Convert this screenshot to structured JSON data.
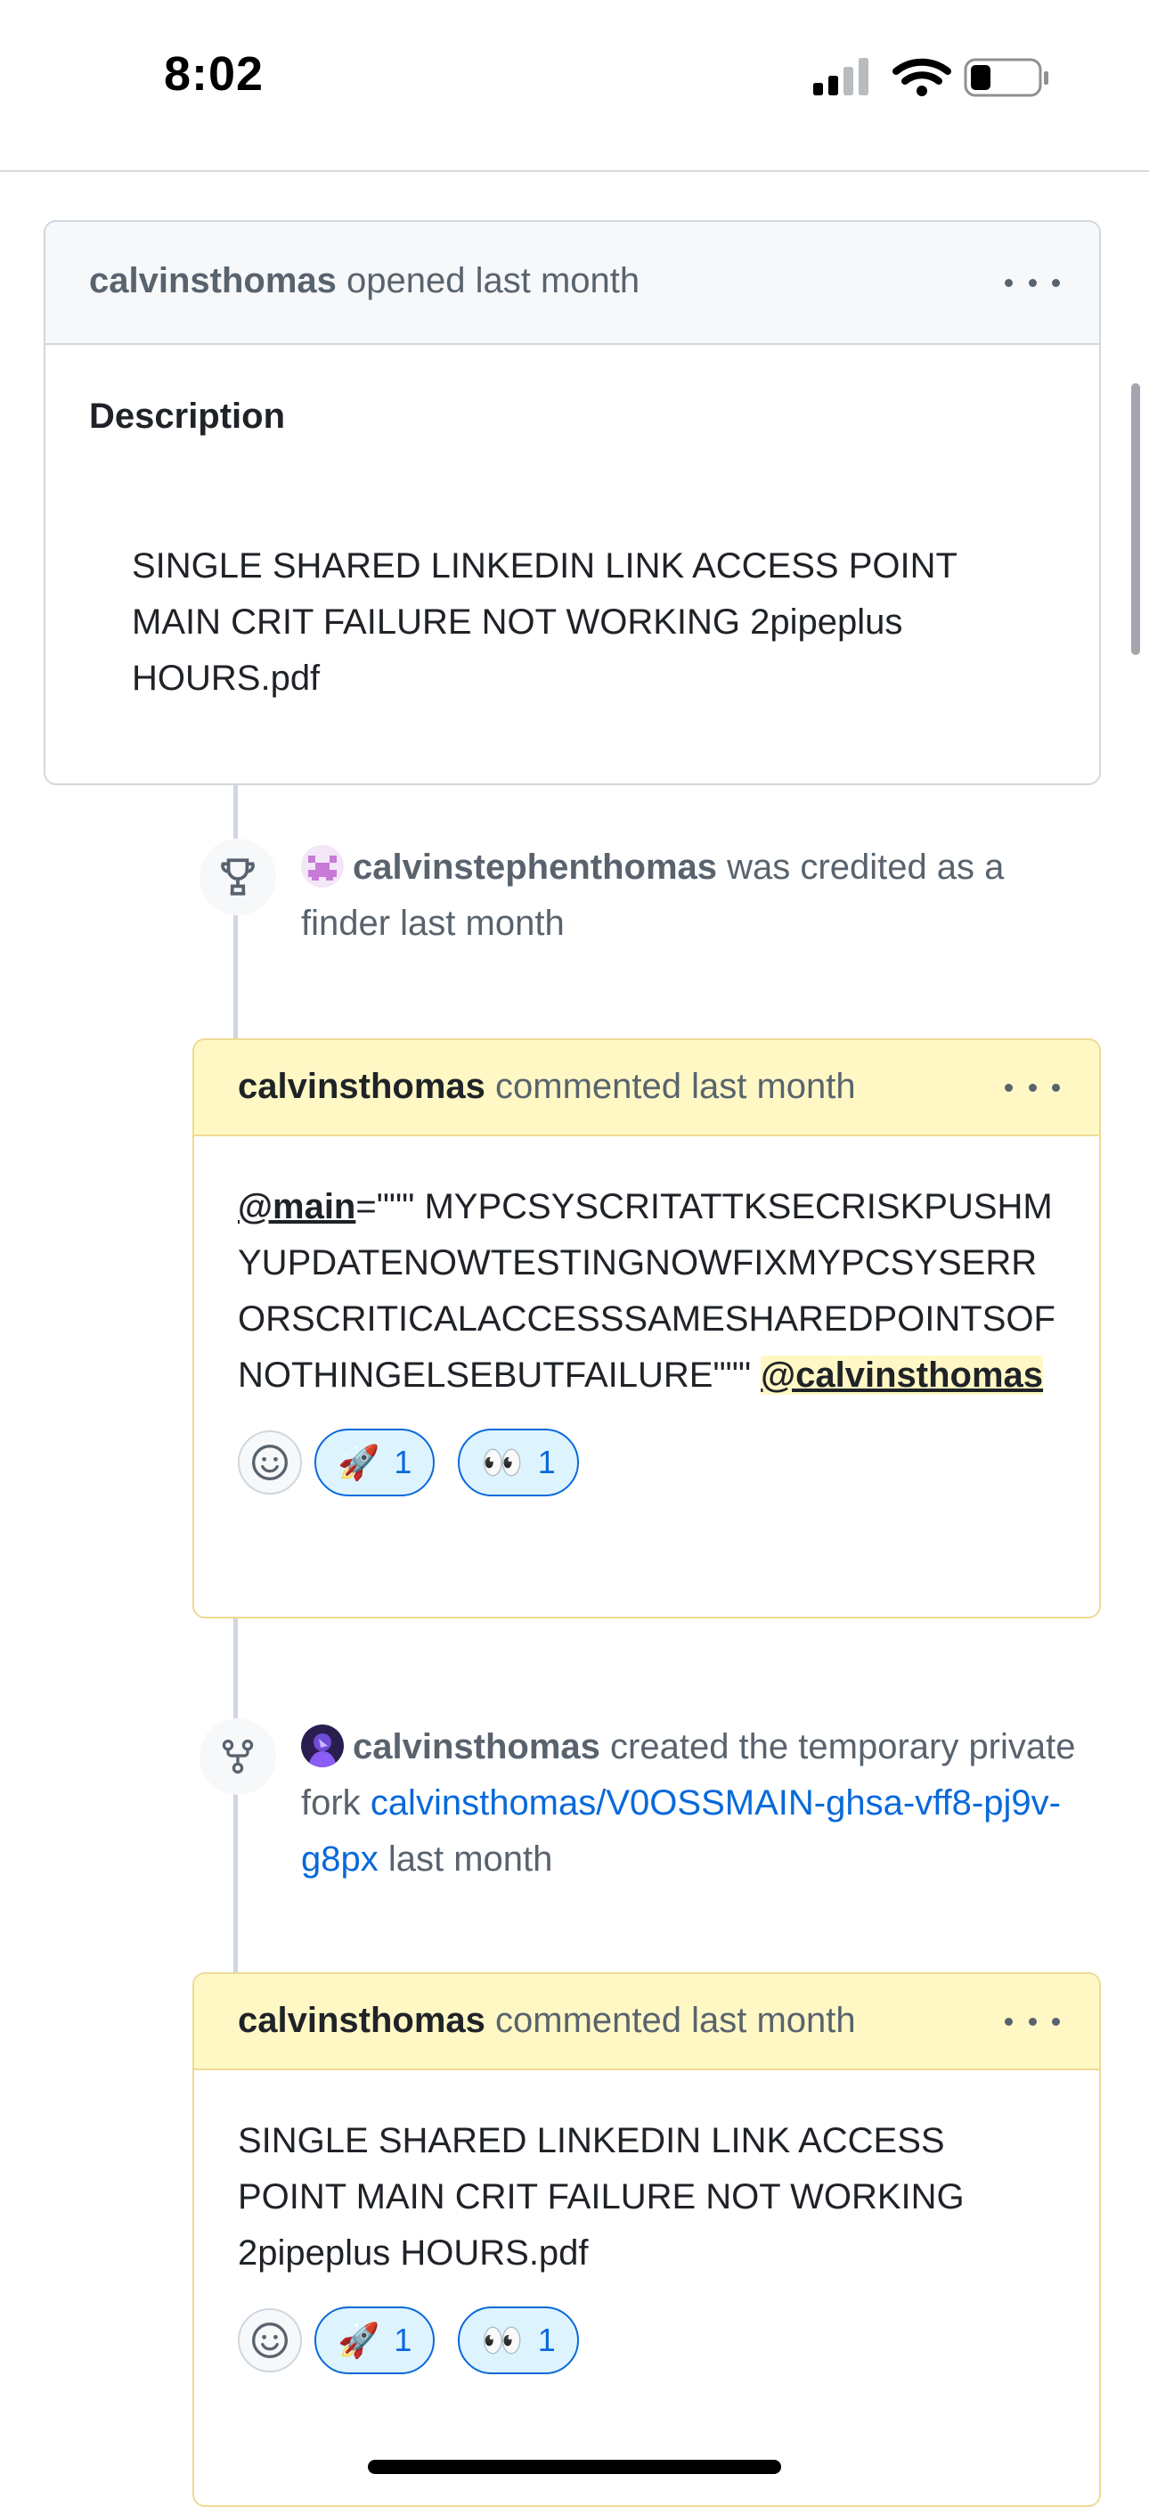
{
  "status_bar": {
    "time": "8:02",
    "icons": [
      "cellular-signal-icon",
      "wifi-icon",
      "battery-icon"
    ]
  },
  "issue": {
    "author": "calvinsthomas",
    "action": "opened last month",
    "description_heading": "Description",
    "description_text": "SINGLE SHARED LINKEDIN LINK ACCESS POINT MAIN CRIT FAILURE NOT WORKING 2pipeplus HOURS.pdf"
  },
  "events": [
    {
      "icon": "trophy-icon",
      "user": "calvinstephenthomas",
      "text": "was credited as a finder last month"
    },
    {
      "icon": "fork-icon",
      "user": "calvinsthomas",
      "text_before": "created the temporary private fork",
      "link": "calvinsthomas/V0OSSMAIN-ghsa-vff8-pj9v-g8px",
      "text_after": "last month"
    }
  ],
  "comments": [
    {
      "author": "calvinsthomas",
      "action": "commented last month",
      "mention_start": "@main",
      "body": "=\"\"\" MYPCSYSCRITATTKSECRISKPUSHMYUPDATENOWTESTINGNOWFIXMYPCSYSERRORSCRITICALACCESSSAMESHAREDPOINTSOFNOTHINGELSEBUTFAILURE\"\"\" ",
      "mention_end": "@calvinsthomas",
      "reactions": [
        {
          "emoji": "🚀",
          "count": "1"
        },
        {
          "emoji": "👀",
          "count": "1"
        }
      ]
    },
    {
      "author": "calvinsthomas",
      "action": "commented last month",
      "body": "SINGLE SHARED LINKEDIN LINK ACCESS POINT MAIN CRIT FAILURE NOT WORKING 2pipeplus HOURS.pdf",
      "reactions": [
        {
          "emoji": "🚀",
          "count": "1"
        },
        {
          "emoji": "👀",
          "count": "1"
        }
      ]
    }
  ],
  "colors": {
    "link": "#0969da",
    "muted": "#59636e",
    "comment_header_bg": "#fff8c5",
    "comment_border": "#eedb93",
    "reaction_bg": "#ddf4ff"
  }
}
